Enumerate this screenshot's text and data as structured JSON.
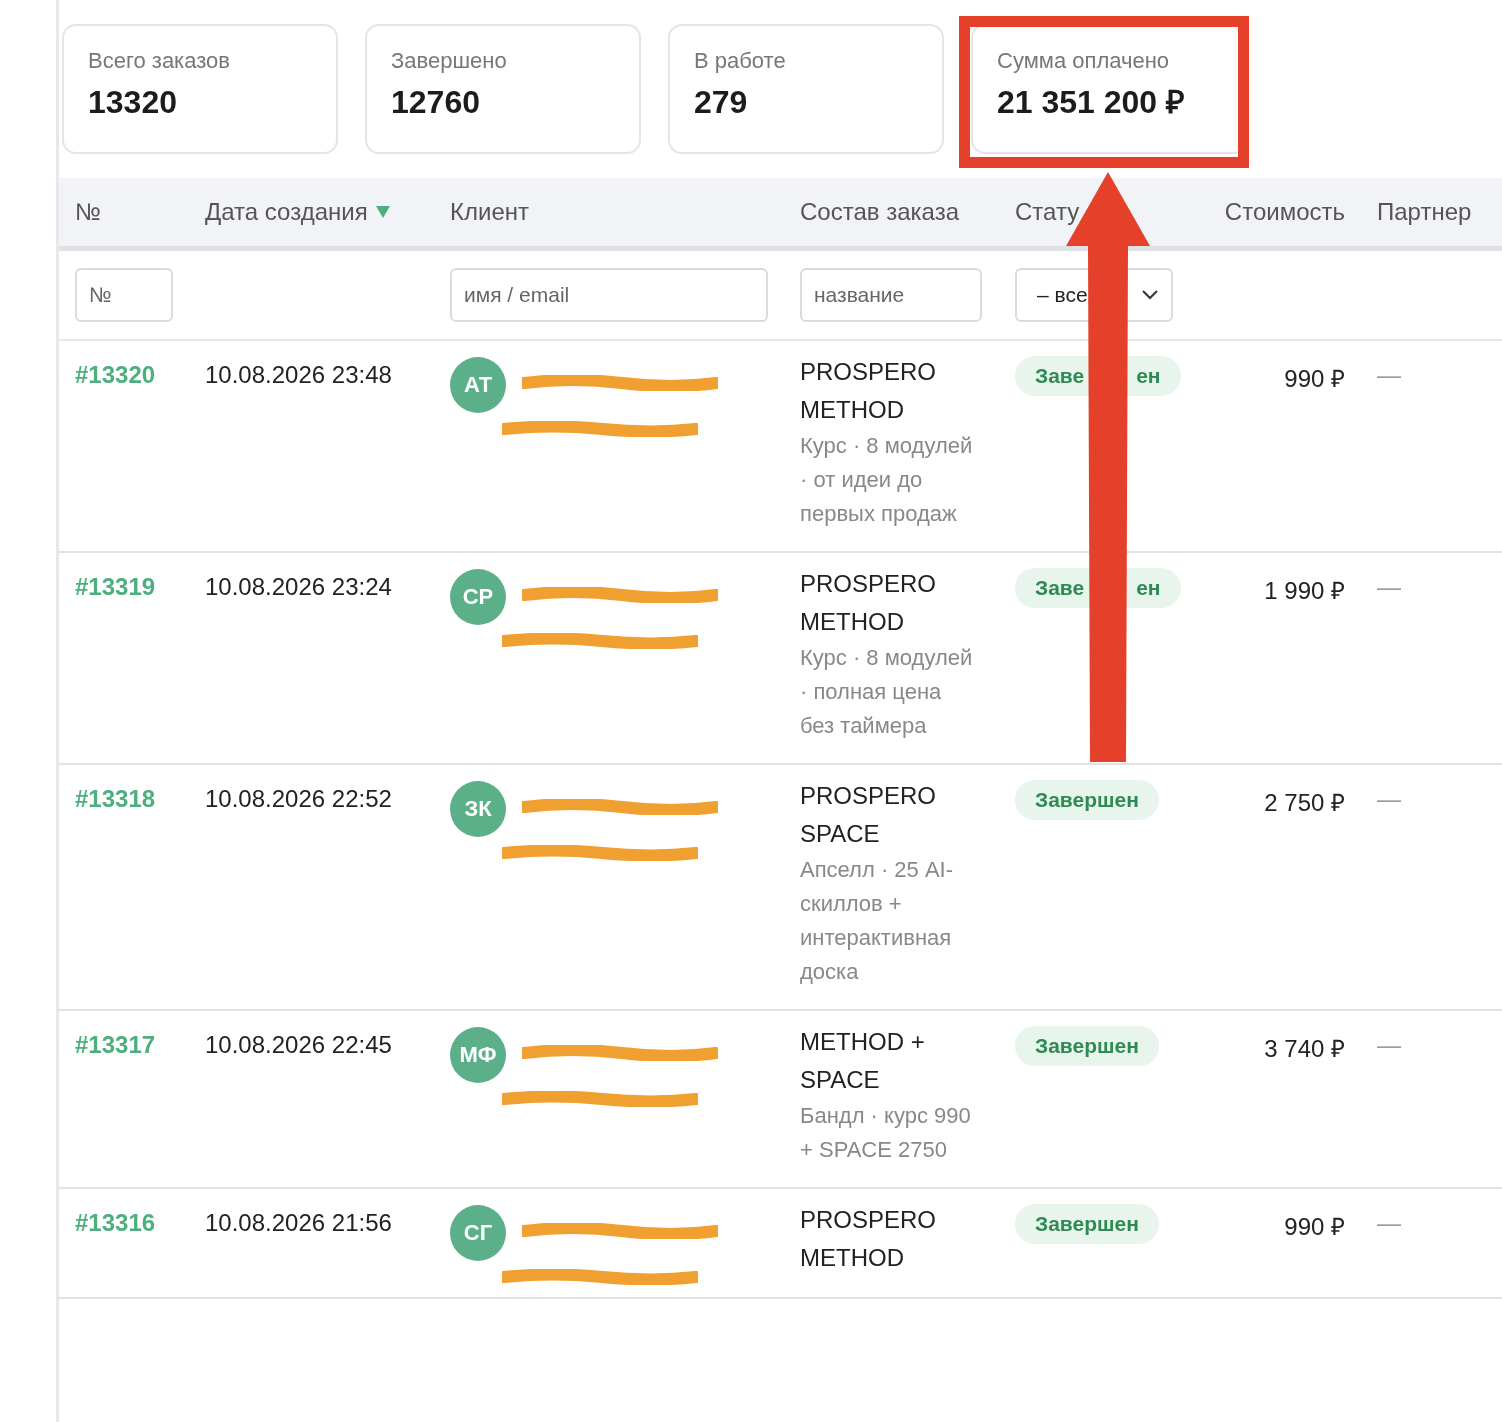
{
  "stats": [
    {
      "label": "Всего заказов",
      "value": "13320",
      "highlighted": false
    },
    {
      "label": "Завершено",
      "value": "12760",
      "highlighted": false
    },
    {
      "label": "В работе",
      "value": "279",
      "highlighted": false
    },
    {
      "label": "Сумма оплачено",
      "value": "21 351 200 ₽",
      "highlighted": true
    }
  ],
  "table": {
    "columns": [
      {
        "label": "№",
        "sorted": false
      },
      {
        "label": "Дата создания",
        "sorted": true
      },
      {
        "label": "Клиент",
        "sorted": false
      },
      {
        "label": "Состав заказа",
        "sorted": false
      },
      {
        "label": "Стату",
        "sorted": false
      },
      {
        "label": "Стоимость",
        "sorted": false
      },
      {
        "label": "Партнер",
        "sorted": false
      }
    ],
    "filters": {
      "number": {
        "placeholder": "№"
      },
      "client": {
        "placeholder": "имя / email"
      },
      "items": {
        "placeholder": "название"
      },
      "status": {
        "value": "– все"
      }
    },
    "rows": [
      {
        "number": "#13320",
        "date": "10.08.2026 23:48",
        "initials": "АТ",
        "title": "PROSPERO METHOD",
        "description": "Курс · 8 модулей · от идеи до первых продаж",
        "status": "Заве",
        "status_end": "ен",
        "cost": "990 ₽",
        "partner": "—"
      },
      {
        "number": "#13319",
        "date": "10.08.2026 23:24",
        "initials": "СР",
        "title": "PROSPERO METHOD",
        "description": "Курс · 8 модулей · полная цена без таймера",
        "status": "Заве",
        "status_end": "ен",
        "cost": "1 990 ₽",
        "partner": "—"
      },
      {
        "number": "#13318",
        "date": "10.08.2026 22:52",
        "initials": "ЗК",
        "title": "PROSPERO SPACE",
        "description": "Апселл · 25 AI-скиллов + интерактивная доска",
        "status": "Завершен",
        "cost": "2 750 ₽",
        "partner": "—"
      },
      {
        "number": "#13317",
        "date": "10.08.2026 22:45",
        "initials": "МФ",
        "title": "METHOD + SPACE",
        "description": "Бандл · курс 990 + SPACE 2750",
        "status": "Завершен",
        "cost": "3 740 ₽",
        "partner": "—"
      },
      {
        "number": "#13316",
        "date": "10.08.2026 21:56",
        "initials": "СГ",
        "title": "PROSPERO METHOD",
        "status": "Завершен",
        "cost": "990 ₽",
        "partner": "—"
      }
    ]
  }
}
